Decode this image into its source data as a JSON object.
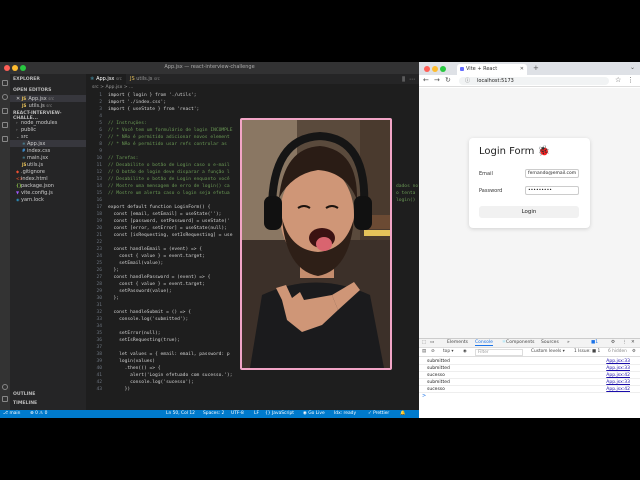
{
  "vscode": {
    "window_title": "App.jsx — react-interview-challenge",
    "sidebar": {
      "explorer_label": "EXPLORER",
      "open_editors_label": "OPEN EDITORS",
      "open_editors": [
        {
          "name": "App.jsx",
          "suffix": "src"
        },
        {
          "name": "utils.js",
          "suffix": "src"
        }
      ],
      "project_label": "REACT-INTERVIEW-CHALLE...",
      "tree": [
        "node_modules",
        "public",
        "src",
        "App.jsx",
        "index.css",
        "main.jsx",
        "utils.js",
        ".gitignore",
        "index.html",
        "package.json",
        "vite.config.js",
        "yarn.lock"
      ],
      "outline_label": "OUTLINE",
      "timeline_label": "TIMELINE"
    },
    "tabs": [
      {
        "label": "App.jsx",
        "suffix": "src"
      },
      {
        "label": "utils.js",
        "suffix": "src"
      }
    ],
    "breadcrumb": "src > App.jsx > ...",
    "code_lines": [
      {
        "n": "1",
        "text": "import { login } from './utils';"
      },
      {
        "n": "2",
        "text": "import './index.css';"
      },
      {
        "n": "3",
        "text": "import { useState } from 'react';"
      },
      {
        "n": "4",
        "text": ""
      },
      {
        "n": "5",
        "text": "// Instruções:"
      },
      {
        "n": "6",
        "text": "// * Você tem um formulário de login INCOMPLE"
      },
      {
        "n": "7",
        "text": "// * NÃo é permitido adicionar novos element"
      },
      {
        "n": "8",
        "text": "// * NÃo é permitido usar refs controlar as"
      },
      {
        "n": "9",
        "text": ""
      },
      {
        "n": "10",
        "text": "// Tarefas:"
      },
      {
        "n": "11",
        "text": "// Desabilite o botão de Login caso o e-mail"
      },
      {
        "n": "12",
        "text": "// O botão de login deve disparar a função l"
      },
      {
        "n": "13",
        "text": "// Desabilite o botão de Login enquanto você"
      },
      {
        "n": "14",
        "text": "// Mostre uma mensagem de erro de login() ca"
      },
      {
        "n": "15",
        "text": "// Mostre um alerta caso o login seja efetua"
      },
      {
        "n": "16",
        "text": ""
      },
      {
        "n": "17",
        "text": "export default function LoginForm() {"
      },
      {
        "n": "18",
        "text": "  const [email, setEmail] = useState('');"
      },
      {
        "n": "19",
        "text": "  const [password, setPassword] = useState('"
      },
      {
        "n": "20",
        "text": "  const [error, setError] = useState(null);"
      },
      {
        "n": "21",
        "text": "  const [isRequesting, setIsRequesting] = use"
      },
      {
        "n": "22",
        "text": ""
      },
      {
        "n": "23",
        "text": "  const handleEmail = (event) => {"
      },
      {
        "n": "24",
        "text": "    const { value } = event.target;"
      },
      {
        "n": "25",
        "text": "    setEmail(value);"
      },
      {
        "n": "26",
        "text": "  };"
      },
      {
        "n": "27",
        "text": "  const handlePassword = (event) => {"
      },
      {
        "n": "28",
        "text": "    const { value } = event.target;"
      },
      {
        "n": "29",
        "text": "    setPassword(value);"
      },
      {
        "n": "30",
        "text": "  };"
      },
      {
        "n": "31",
        "text": ""
      },
      {
        "n": "32",
        "text": "  const handleSubmit = () => {"
      },
      {
        "n": "33",
        "text": "    console.log('submitted');"
      },
      {
        "n": "34",
        "text": ""
      },
      {
        "n": "35",
        "text": "    setError(null);"
      },
      {
        "n": "36",
        "text": "    setIsRequesting(true);"
      },
      {
        "n": "37",
        "text": ""
      },
      {
        "n": "38",
        "text": "    let values = { email: email, password: p"
      },
      {
        "n": "39",
        "text": "    login(values)"
      },
      {
        "n": "40",
        "text": "      .then(() => {"
      },
      {
        "n": "41",
        "text": "        alert('Login efetuado com sucesso.');"
      },
      {
        "n": "42",
        "text": "        console.log('sucesso');"
      },
      {
        "n": "43",
        "text": "      })"
      }
    ],
    "right_overflow": [
      {
        "line": 14,
        "text": "dados no"
      },
      {
        "line": 15,
        "text": "o tenta"
      },
      {
        "line": 16,
        "text": "login()"
      }
    ],
    "statusbar": {
      "branch": "main",
      "errors": "⊗ 0 ⚠ 0",
      "position": "Ln 50, Col 12",
      "spaces": "Spaces: 2",
      "encoding": "UTF-8",
      "eol": "LF",
      "language": "{} JavaScript",
      "golive": "Go Live",
      "idx": "Idx: ready",
      "prettier": "✓ Prettier"
    }
  },
  "browser": {
    "tab_title": "Vite + React",
    "url": "localhost:5173",
    "page": {
      "title": "Login Form 🐞",
      "email_label": "Email",
      "email_value": "fernando@email.com",
      "password_label": "Password",
      "password_value": "•••••••••",
      "login_button": "Login"
    },
    "devtools": {
      "tabs": [
        "Elements",
        "Console",
        "Components",
        "Sources"
      ],
      "active_tab": "Console",
      "context": "top",
      "filter_placeholder": "Filter",
      "levels": "Custom levels ▾",
      "issues": "1 Issue: ■ 1",
      "hidden": "6 hidden",
      "logs": [
        {
          "msg": "submitted",
          "src": "App.jsx:33"
        },
        {
          "msg": "submitted",
          "src": "App.jsx:33"
        },
        {
          "msg": "sucesso",
          "src": "App.jsx:42"
        },
        {
          "msg": "submitted",
          "src": "App.jsx:33"
        },
        {
          "msg": "sucesso",
          "src": "App.jsx:42"
        }
      ],
      "prompt": ">"
    }
  },
  "colors": {
    "vscode_bg": "#1e1e1e",
    "statusbar": "#007acc",
    "webcam_border": "#f2a5c7",
    "devtools_accent": "#1a73e8"
  }
}
